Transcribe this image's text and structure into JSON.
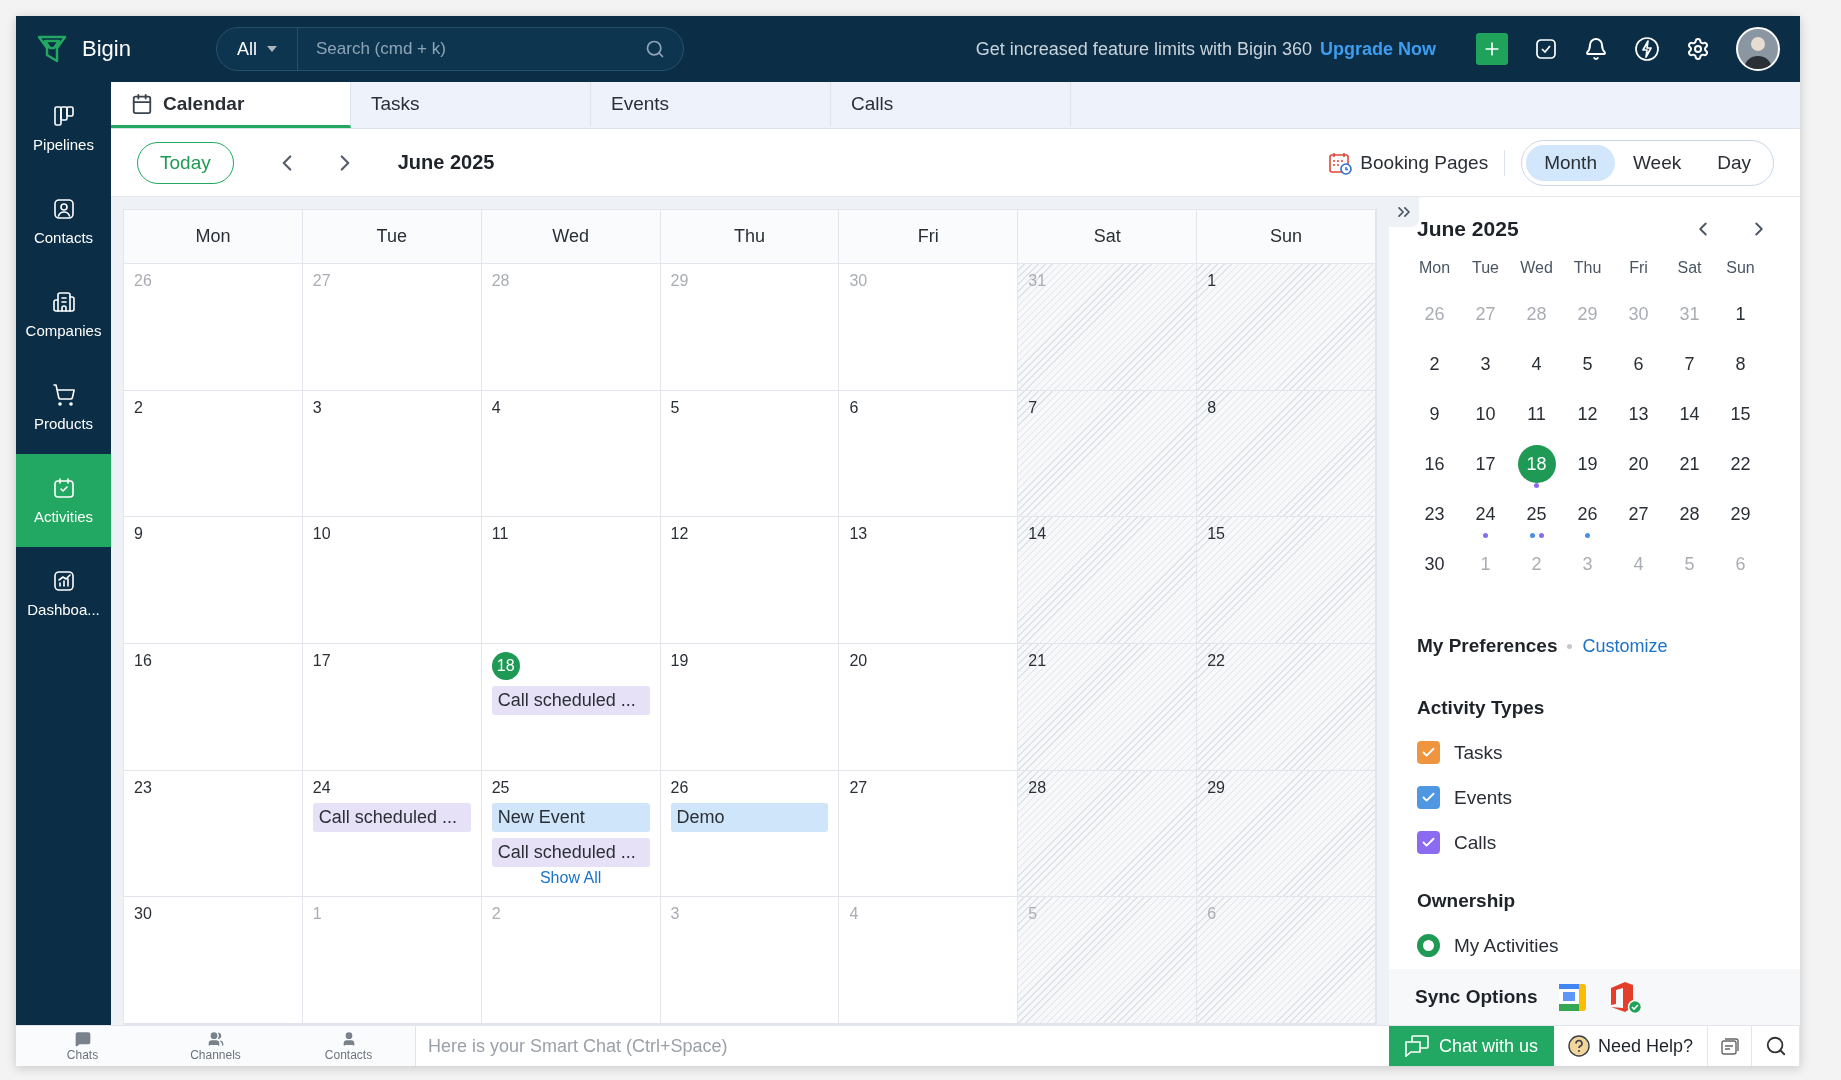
{
  "top_bar": {
    "app_name": "Bigin",
    "search_scope": "All",
    "search_placeholder": "Search (cmd + k)",
    "promo_text": "Get increased feature limits with Bigin 360",
    "promo_link": "Upgrade Now"
  },
  "sidebar": {
    "items": [
      {
        "label": "Pipelines",
        "selected": false
      },
      {
        "label": "Contacts",
        "selected": false
      },
      {
        "label": "Companies",
        "selected": false
      },
      {
        "label": "Products",
        "selected": false
      },
      {
        "label": "Activities",
        "selected": true
      },
      {
        "label": "Dashboa...",
        "selected": false
      }
    ]
  },
  "tabs": [
    {
      "label": "Calendar",
      "selected": true
    },
    {
      "label": "Tasks",
      "selected": false
    },
    {
      "label": "Events",
      "selected": false
    },
    {
      "label": "Calls",
      "selected": false
    }
  ],
  "toolbar": {
    "today": "Today",
    "period": "June 2025",
    "booking": "Booking Pages",
    "views": [
      {
        "label": "Month",
        "selected": true
      },
      {
        "label": "Week",
        "selected": false
      },
      {
        "label": "Day",
        "selected": false
      }
    ]
  },
  "calendar": {
    "weekdays": [
      {
        "label": "Mon",
        "weekend": false
      },
      {
        "label": "Tue",
        "weekend": false
      },
      {
        "label": "Wed",
        "weekend": false
      },
      {
        "label": "Thu",
        "weekend": false
      },
      {
        "label": "Fri",
        "weekend": false
      },
      {
        "label": "Sat",
        "weekend": true
      },
      {
        "label": "Sun",
        "weekend": true
      }
    ],
    "weeks": [
      {
        "days": [
          {
            "label": "26",
            "muted": true,
            "today": false
          },
          {
            "label": "27",
            "muted": true,
            "today": false
          },
          {
            "label": "28",
            "muted": true,
            "today": false
          },
          {
            "label": "29",
            "muted": true,
            "today": false
          },
          {
            "label": "30",
            "muted": true,
            "today": false
          },
          {
            "label": "31",
            "muted": true,
            "today": false
          },
          {
            "label": "1",
            "muted": false,
            "today": false
          }
        ]
      },
      {
        "days": [
          {
            "label": "2",
            "muted": false,
            "today": false
          },
          {
            "label": "3",
            "muted": false,
            "today": false
          },
          {
            "label": "4",
            "muted": false,
            "today": false
          },
          {
            "label": "5",
            "muted": false,
            "today": false
          },
          {
            "label": "6",
            "muted": false,
            "today": false
          },
          {
            "label": "7",
            "muted": false,
            "today": false
          },
          {
            "label": "8",
            "muted": false,
            "today": false
          }
        ]
      },
      {
        "days": [
          {
            "label": "9",
            "muted": false,
            "today": false
          },
          {
            "label": "10",
            "muted": false,
            "today": false
          },
          {
            "label": "11",
            "muted": false,
            "today": false
          },
          {
            "label": "12",
            "muted": false,
            "today": false
          },
          {
            "label": "13",
            "muted": false,
            "today": false
          },
          {
            "label": "14",
            "muted": false,
            "today": false
          },
          {
            "label": "15",
            "muted": false,
            "today": false
          }
        ]
      },
      {
        "days": [
          {
            "label": "16",
            "muted": false,
            "today": false
          },
          {
            "label": "17",
            "muted": false,
            "today": false
          },
          {
            "label": "18",
            "muted": false,
            "today": true,
            "events": [
              {
                "title": "Call scheduled ...",
                "kind": "call"
              }
            ]
          },
          {
            "label": "19",
            "muted": false,
            "today": false
          },
          {
            "label": "20",
            "muted": false,
            "today": false
          },
          {
            "label": "21",
            "muted": false,
            "today": false
          },
          {
            "label": "22",
            "muted": false,
            "today": false
          }
        ]
      },
      {
        "days": [
          {
            "label": "23",
            "muted": false,
            "today": false
          },
          {
            "label": "24",
            "muted": false,
            "today": false,
            "events": [
              {
                "title": "Call scheduled ...",
                "kind": "call"
              }
            ]
          },
          {
            "label": "25",
            "muted": false,
            "today": false,
            "events": [
              {
                "title": "New Event",
                "kind": "event"
              },
              {
                "title": "Call scheduled ...",
                "kind": "call"
              }
            ],
            "more": "Show All"
          },
          {
            "label": "26",
            "muted": false,
            "today": false,
            "events": [
              {
                "title": "Demo",
                "kind": "event"
              }
            ]
          },
          {
            "label": "27",
            "muted": false,
            "today": false
          },
          {
            "label": "28",
            "muted": false,
            "today": false
          },
          {
            "label": "29",
            "muted": false,
            "today": false
          }
        ]
      },
      {
        "days": [
          {
            "label": "30",
            "muted": false,
            "today": false
          },
          {
            "label": "1",
            "muted": true,
            "today": false
          },
          {
            "label": "2",
            "muted": true,
            "today": false
          },
          {
            "label": "3",
            "muted": true,
            "today": false
          },
          {
            "label": "4",
            "muted": true,
            "today": false
          },
          {
            "label": "5",
            "muted": true,
            "today": false
          },
          {
            "label": "6",
            "muted": true,
            "today": false
          }
        ]
      }
    ]
  },
  "side_panel": {
    "title": "June 2025",
    "weekdays": [
      "Mon",
      "Tue",
      "Wed",
      "Thu",
      "Fri",
      "Sat",
      "Sun"
    ],
    "weeks": [
      {
        "days": [
          {
            "label": "26",
            "muted": true,
            "selected": false
          },
          {
            "label": "27",
            "muted": true,
            "selected": false
          },
          {
            "label": "28",
            "muted": true,
            "selected": false
          },
          {
            "label": "29",
            "muted": true,
            "selected": false
          },
          {
            "label": "30",
            "muted": true,
            "selected": false
          },
          {
            "label": "31",
            "muted": true,
            "selected": false
          },
          {
            "label": "1",
            "muted": false,
            "selected": false
          }
        ]
      },
      {
        "days": [
          {
            "label": "2",
            "muted": false,
            "selected": false
          },
          {
            "label": "3",
            "muted": false,
            "selected": false
          },
          {
            "label": "4",
            "muted": false,
            "selected": false
          },
          {
            "label": "5",
            "muted": false,
            "selected": false
          },
          {
            "label": "6",
            "muted": false,
            "selected": false
          },
          {
            "label": "7",
            "muted": false,
            "selected": false
          },
          {
            "label": "8",
            "muted": false,
            "selected": false
          }
        ]
      },
      {
        "days": [
          {
            "label": "9",
            "muted": false,
            "selected": false
          },
          {
            "label": "10",
            "muted": false,
            "selected": false
          },
          {
            "label": "11",
            "muted": false,
            "selected": false
          },
          {
            "label": "12",
            "muted": false,
            "selected": false
          },
          {
            "label": "13",
            "muted": false,
            "selected": false
          },
          {
            "label": "14",
            "muted": false,
            "selected": false
          },
          {
            "label": "15",
            "muted": false,
            "selected": false
          }
        ]
      },
      {
        "days": [
          {
            "label": "16",
            "muted": false,
            "selected": false
          },
          {
            "label": "17",
            "muted": false,
            "selected": false
          },
          {
            "label": "18",
            "muted": false,
            "selected": true,
            "dots": [
              {
                "color": "#8b6cf0"
              }
            ]
          },
          {
            "label": "19",
            "muted": false,
            "selected": false
          },
          {
            "label": "20",
            "muted": false,
            "selected": false
          },
          {
            "label": "21",
            "muted": false,
            "selected": false
          },
          {
            "label": "22",
            "muted": false,
            "selected": false
          }
        ]
      },
      {
        "days": [
          {
            "label": "23",
            "muted": false,
            "selected": false
          },
          {
            "label": "24",
            "muted": false,
            "selected": false,
            "dots": [
              {
                "color": "#8b6cf0"
              }
            ]
          },
          {
            "label": "25",
            "muted": false,
            "selected": false,
            "dots": [
              {
                "color": "#4a90e2"
              },
              {
                "color": "#8b6cf0"
              }
            ]
          },
          {
            "label": "26",
            "muted": false,
            "selected": false,
            "dots": [
              {
                "color": "#4a90e2"
              }
            ]
          },
          {
            "label": "27",
            "muted": false,
            "selected": false
          },
          {
            "label": "28",
            "muted": false,
            "selected": false
          },
          {
            "label": "29",
            "muted": false,
            "selected": false
          }
        ]
      },
      {
        "days": [
          {
            "label": "30",
            "muted": false,
            "selected": false
          },
          {
            "label": "1",
            "muted": true,
            "selected": false
          },
          {
            "label": "2",
            "muted": true,
            "selected": false
          },
          {
            "label": "3",
            "muted": true,
            "selected": false
          },
          {
            "label": "4",
            "muted": true,
            "selected": false
          },
          {
            "label": "5",
            "muted": true,
            "selected": false
          },
          {
            "label": "6",
            "muted": true,
            "selected": false
          }
        ]
      }
    ],
    "preferences_title": "My Preferences",
    "customize": "Customize",
    "activity_title": "Activity Types",
    "activity_types": [
      {
        "label": "Tasks",
        "checked": true,
        "color": "#f0953f"
      },
      {
        "label": "Events",
        "checked": true,
        "color": "#4f97e0"
      },
      {
        "label": "Calls",
        "checked": true,
        "color": "#8b6cf0"
      }
    ],
    "ownership_title": "Ownership",
    "ownership": [
      {
        "label": "My Activities",
        "selected": true
      }
    ],
    "sync_title": "Sync Options"
  },
  "bottom_bar": {
    "items": [
      {
        "label": "Chats"
      },
      {
        "label": "Channels"
      },
      {
        "label": "Contacts"
      }
    ],
    "chat_placeholder": "Here is your Smart Chat (Ctrl+Space)",
    "chat_button": "Chat with us",
    "help": "Need Help?"
  }
}
